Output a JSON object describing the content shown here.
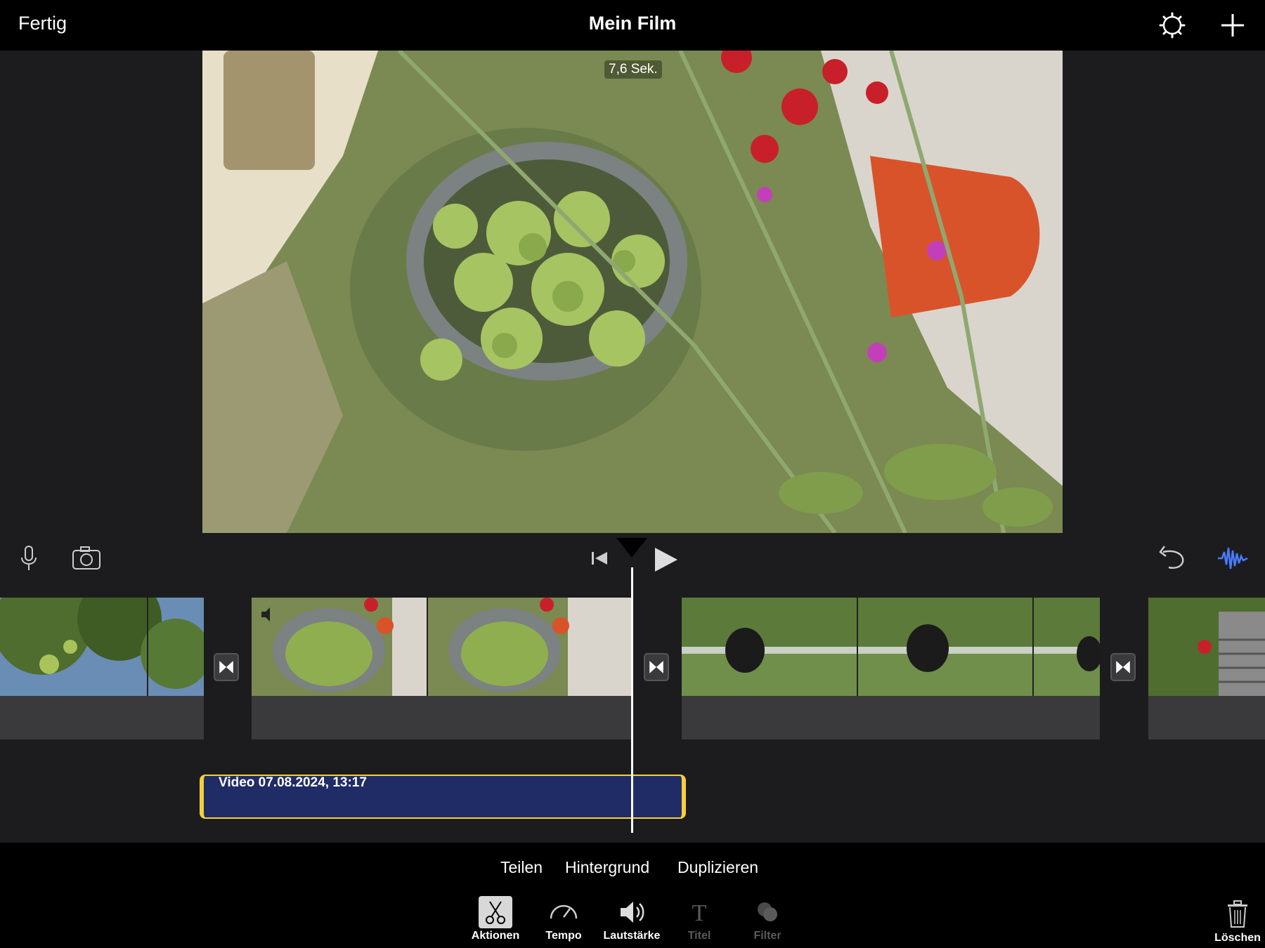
{
  "header": {
    "done_label": "Fertig",
    "title": "Mein Film"
  },
  "preview": {
    "duration_label": "7,6 Sek."
  },
  "timeline": {
    "audio_clip_label": "Video 07.08.2024, 13:17"
  },
  "clip_actions": [
    "Teilen",
    "Hintergrund",
    "Duplizieren"
  ],
  "toolbar": {
    "items": [
      {
        "label": "Aktionen",
        "icon": "scissors-icon",
        "selected": true
      },
      {
        "label": "Tempo",
        "icon": "speedometer-icon"
      },
      {
        "label": "Lautstärke",
        "icon": "speaker-icon"
      },
      {
        "label": "Titel",
        "icon": "title-icon",
        "disabled": true
      },
      {
        "label": "Filter",
        "icon": "filter-icon",
        "disabled": true
      }
    ],
    "delete_label": "Löschen"
  },
  "colors": {
    "accent": "#f6cf3a",
    "audio_clip": "#1f2c66",
    "waveform_icon": "#4a7bff"
  }
}
